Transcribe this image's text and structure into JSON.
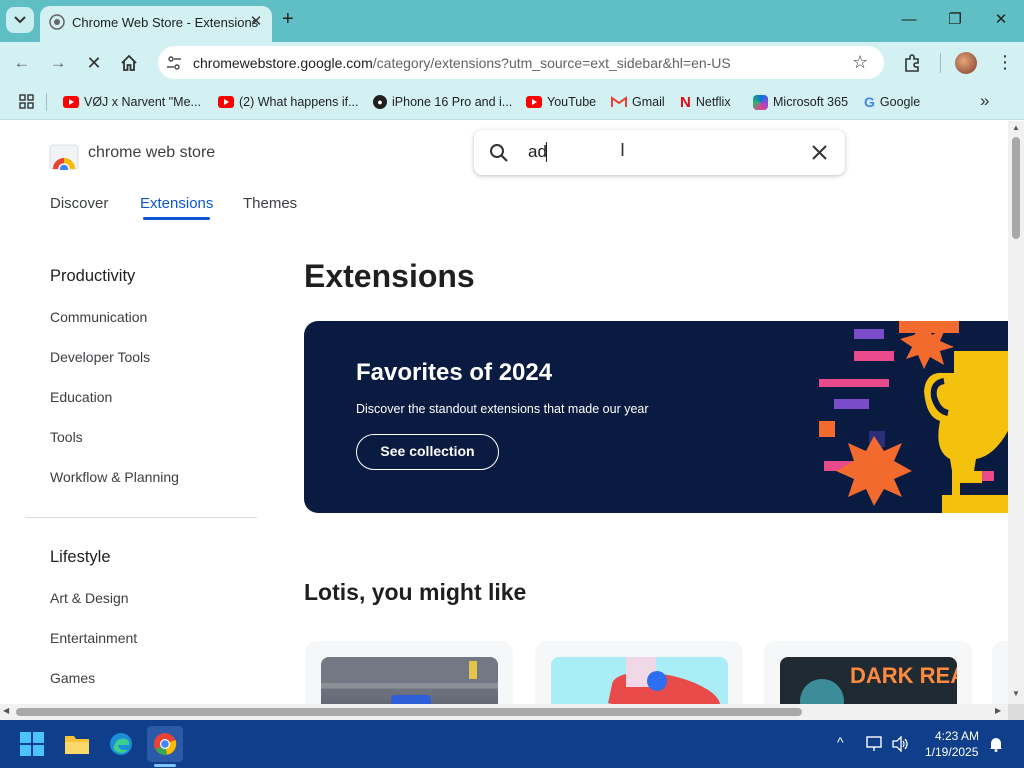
{
  "tab": {
    "title": "Chrome Web Store - Extensions"
  },
  "address_bar": {
    "host": "chromewebstore.google.com",
    "path": "/category/extensions?utm_source=ext_sidebar&hl=en-US"
  },
  "bookmarks": [
    {
      "label": "VØJ x Narvent \"Me...",
      "icon": "youtube-icon"
    },
    {
      "label": "(2) What happens if...",
      "icon": "youtube-icon"
    },
    {
      "label": "iPhone 16 Pro and i...",
      "icon": "apple-icon"
    },
    {
      "label": "YouTube",
      "icon": "youtube-icon"
    },
    {
      "label": "Gmail",
      "icon": "gmail-icon"
    },
    {
      "label": "Netflix",
      "icon": "netflix-icon"
    },
    {
      "label": "Microsoft 365",
      "icon": "microsoft365-icon"
    },
    {
      "label": "Google",
      "icon": "google-icon"
    }
  ],
  "store": {
    "name": "chrome web store"
  },
  "search": {
    "value": "ad"
  },
  "nav": {
    "discover": "Discover",
    "extensions": "Extensions",
    "themes": "Themes"
  },
  "sidebar": {
    "productivity": {
      "heading": "Productivity",
      "items": [
        "Communication",
        "Developer Tools",
        "Education",
        "Tools",
        "Workflow & Planning"
      ]
    },
    "lifestyle": {
      "heading": "Lifestyle",
      "items": [
        "Art & Design",
        "Entertainment",
        "Games"
      ]
    }
  },
  "main": {
    "heading": "Extensions",
    "banner": {
      "title": "Favorites of 2024",
      "subtitle": "Discover the standout extensions that made our year",
      "button": "See collection"
    },
    "recommendations": {
      "heading": "Lotis, you might like",
      "cards": [
        {
          "image": "street-scene"
        },
        {
          "image": "3d-shapes"
        },
        {
          "image_text": "DARK READER"
        }
      ]
    }
  },
  "taskbar": {
    "time": "4:23 AM",
    "date": "1/19/2025"
  },
  "colors": {
    "browser_frame": "#60bfc4",
    "toolbar": "#d3f1f3",
    "accent_blue": "#0b57d0",
    "banner_bg": "#0a1b42",
    "taskbar": "#0f3f8a"
  }
}
